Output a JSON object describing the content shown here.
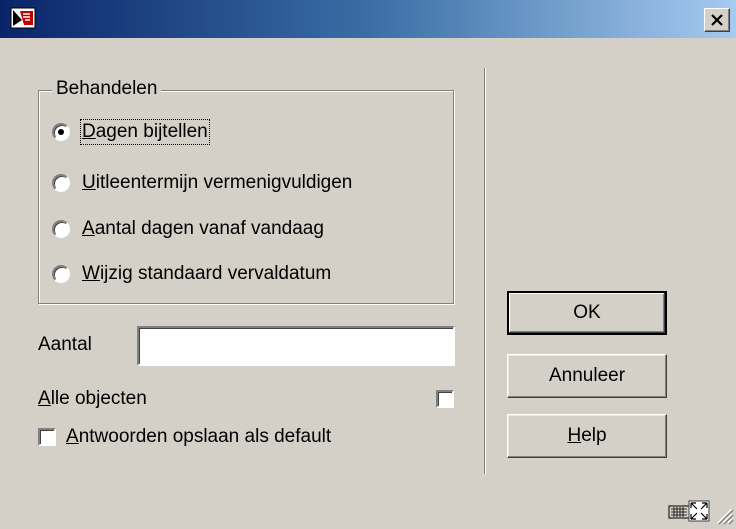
{
  "window": {
    "title": ""
  },
  "group": {
    "label": "Behandelen",
    "options": [
      {
        "prefix": "",
        "accel": "D",
        "rest": "agen bijtellen",
        "checked": true
      },
      {
        "prefix": "",
        "accel": "U",
        "rest": "itleentermijn vermenigvuldigen",
        "checked": false
      },
      {
        "prefix": "",
        "accel": "A",
        "rest": "antal dagen vanaf vandaag",
        "checked": false
      },
      {
        "prefix": "",
        "accel": "W",
        "rest": "ijzig standaard vervaldatum",
        "checked": false
      }
    ]
  },
  "aantal": {
    "label": "Aantal",
    "value": ""
  },
  "alle_objecten": {
    "accel": "A",
    "rest": "lle objecten",
    "checked": false
  },
  "antwoorden": {
    "accel": "A",
    "rest": "ntwoorden opslaan als default",
    "checked": false
  },
  "buttons": {
    "ok": "OK",
    "annuleer": "Annuleer",
    "help_accel": "H",
    "help_rest": "elp"
  },
  "icons": {
    "app": "app-logo-icon",
    "close": "close-icon",
    "keyboard": "keyboard-icon",
    "expand": "expand-icon",
    "grip": "resize-grip-icon"
  }
}
